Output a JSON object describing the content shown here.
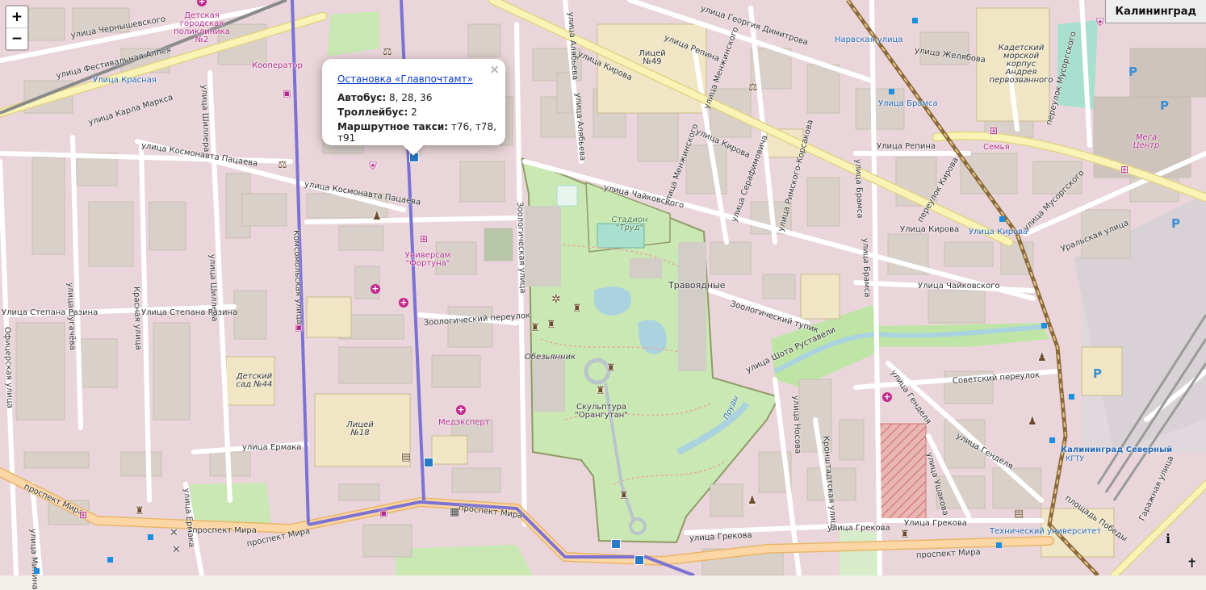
{
  "zoom": {
    "in_label": "+",
    "out_label": "−"
  },
  "city": "Калининград",
  "popup": {
    "close": "×",
    "title": "Остановка «Главпочтамт»",
    "rows": [
      {
        "label": "Автобус:",
        "value": " 8, 28, 36"
      },
      {
        "label": "Троллейбус:",
        "value": " 2"
      },
      {
        "label": "Маршрутное такси:",
        "value": " т76, т78, т91"
      }
    ]
  },
  "streets": {
    "chernyshevskogo": "улица Чернышевского",
    "festivalnaya": "улица Фестивальная Аллея",
    "karla_marksa": "улица Карла Маркса",
    "krasnaya_stop": "Улица Красная",
    "shillera_a": "улица Шиллера",
    "shillera_b": "улица Шиллера",
    "pacaeva_a": "улица Космонавта Пацаева",
    "pacaeva_b": "улица Космонавта Пацаева",
    "komsomolskaya": "Комсомольская улица",
    "alyabeva_a": "улица Алябьева",
    "alyabeva_b": "улица Алябьева",
    "kirova_a": "улица Кирова",
    "kirova_b": "улица Кирова",
    "kirova_c": "Улица Кирова",
    "dimitrova": "улица Георгия Димитрова",
    "repina_a": "улица Репина",
    "repina_b": "Улица Репина",
    "menzhinskogo_a": "улица Менжинского",
    "menzhinskogo_b": "улица Менжинского",
    "narvskaya": "Нарвская улица",
    "zhelyabova": "улица Желябова",
    "bramsa_stop": "Улица Брамса",
    "bramsa": "улица Брамса",
    "bramsa_b": "улица Брамса",
    "chaykovskogo_a": "улица Чайковского",
    "chaykovskogo_b": "Улица Чайковского",
    "serafimovicha": "улица Серафимовича",
    "rimskogo": "улица Римского-Корсакова",
    "pereulok_kirova": "переулок Кирова",
    "kirova_stop": "Улица Кирова",
    "mussorgskogo_a": "переулок Мусоргского",
    "mussorgskogo_b": "улица Мусоргского",
    "uralskaya": "Уральская улица",
    "pugacheva": "улица Пугачёва",
    "krasnaya": "Красная улица",
    "razina_a": "Улица Степана Разина",
    "razina_b": "Улица Степана Разина",
    "oficerskaya": "Офицерская улица",
    "zoologicheskaya": "Зоологическая улица",
    "zoo_pereulok": "Зоологический переулок",
    "zoo_tupik": "Зоологический тупик",
    "rustaveli": "улица Шота Руставели",
    "nosova": "улица Носова",
    "kronshtadtskaya": "Кронштадтская улица",
    "ushakova": "улица Ушакова",
    "gendelya_a": "улица Генделя",
    "gendelya_b": "улица Генделя",
    "sovetsky": "Советский переулок",
    "ermaka": "улица Ермака",
    "ermaka_b": "улица Ермака",
    "mira_a": "проспект Мира",
    "mira_b": "проспект Мира",
    "mira_c": "проспект Мира",
    "mira_d": "проспект Мира",
    "mira_e": "проспект Мира",
    "grekova_a": "улица Грекова",
    "grekova_b": "улица Грекова",
    "grekova_c": "Улица Грекова",
    "garazhnaya": "Гаражная улица",
    "ploschad_pobedy": "площадь Победы",
    "minina": "улица Минина"
  },
  "pois": {
    "poliklinika": "Детская\nгородская\nполиклиника\n№2",
    "kooperator": "Кооператор",
    "licey49": "Лицей\n№49",
    "kadetsky": "Кадетский\nморской\nкорпус\nАндрея\nпервозванного",
    "mega": "Мега\nЦентр",
    "semya": "Семья",
    "stadion": "Стадион\n\"Труд\"",
    "fortuna": "Универсам\n\"Фортуна\"",
    "travoyadnye": "Травоядные",
    "obezyannik": "Обезьянник",
    "skulptura": "Скульптура\n\"Орангутан\"",
    "sad44": "Детский\nсад №44",
    "licey18": "Лицей\n№18",
    "medekspert": "Медэксперт",
    "kaliningrad_severny": "Калининград Северный",
    "kgtu": "КГТУ",
    "tekh_univ": "Технический университет",
    "prudy": "Пруды"
  },
  "colors": {
    "background": "#f2efe9",
    "residential": "#e8d2d6",
    "building": "#d9d0c9",
    "park": "#c8eab3",
    "trolley_route": "#7b72d4",
    "major_road": "#f9f3b5",
    "railway": "#8a6a3a",
    "poi_magenta": "#b5298c",
    "transit_blue": "#2366b5"
  },
  "icons": [
    "plus-icon",
    "minus-icon",
    "close-icon",
    "bus-stop-icon",
    "pharmacy-icon",
    "shop-icon",
    "parking-icon",
    "monument-icon",
    "library-icon",
    "hospital-icon",
    "courthouse-icon",
    "cinema-icon",
    "police-icon",
    "church-icon"
  ]
}
